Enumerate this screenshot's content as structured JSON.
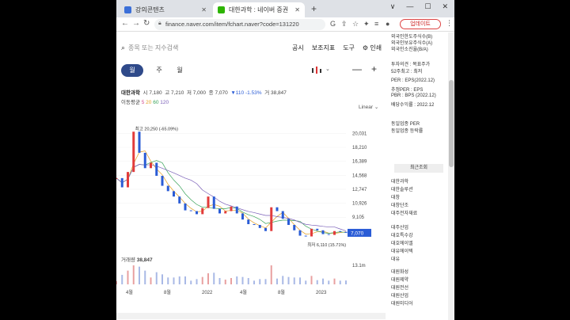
{
  "browser": {
    "tabs": [
      {
        "title": "강의콘텐츠",
        "favicon_color": "#3b6fd8"
      },
      {
        "title": "대한과학 : 네이버 증권",
        "favicon_color": "#2db400"
      }
    ],
    "new_tab": "+",
    "window_controls": [
      "∨",
      "—",
      "☐",
      "✕"
    ],
    "url": "finance.naver.com/item/fchart.naver?code=131220",
    "update_button": "업데이트",
    "menu": "⋮"
  },
  "toolbar": {
    "search_placeholder": "종목 또는 지수검색",
    "links": [
      "공시",
      "보조지표",
      "도구",
      "인쇄"
    ]
  },
  "period_tabs": [
    "월",
    "주",
    "월"
  ],
  "quote": {
    "name": "대한과학",
    "open_label": "시",
    "open": "7,180",
    "high_label": "고",
    "high": "7,210",
    "low_label": "저",
    "low": "7,000",
    "close_label": "종",
    "close": "7,070",
    "change": "▼110",
    "change_pct": "-1.53%",
    "volume_label": "거",
    "volume": "38,847"
  },
  "moving_average": {
    "label": "이동평균",
    "values": [
      "5",
      "20",
      "60",
      "120"
    ],
    "colors": [
      "#d14b8f",
      "#e39d1f",
      "#3aa35a",
      "#7a5fb8"
    ]
  },
  "scale_mode": "Linear",
  "chart_data": {
    "type": "line",
    "ylim": [
      5000,
      21000
    ],
    "y_ticks": [
      "20,031",
      "18,210",
      "16,389",
      "14,568",
      "12,747",
      "10,926",
      "9,105"
    ],
    "x_ticks": [
      "4월",
      "8월",
      "2022",
      "4월",
      "8월",
      "2023"
    ],
    "current_price_tag": "7,070",
    "annotations": [
      {
        "text": "최고 20,250 (-65.09%)",
        "y": 20250
      },
      {
        "text": "최저 6,110 (15.71%)",
        "y": 6110
      }
    ],
    "volume_label": "거래량",
    "volume_value": "38,847",
    "volume_tick": "13.1m",
    "series": [
      {
        "values": [
          14200,
          13000,
          15000,
          20250,
          17500,
          15500,
          16200,
          14500,
          13200,
          12500,
          11800,
          10900,
          10000,
          9900,
          9500,
          10300,
          11800,
          10200,
          9600,
          9900,
          10500,
          9600,
          8800,
          8200,
          8100,
          7700,
          7300,
          10400,
          9900,
          8900,
          8100,
          7400,
          6700,
          6600,
          7600,
          7400,
          6900,
          6800,
          7300,
          7200,
          7070
        ]
      }
    ]
  },
  "right_panel": {
    "lines": [
      "외국인한도주식수(B)",
      "외국인보유주식수(A)",
      "외국인소진율(B/A)",
      "투자의견 : 목표주가",
      "52주최고 : 최저",
      "PER : EPS(2022.12)",
      "추정PER : EPS",
      "PBR : BPS (2022.12)",
      "배당수익률 : 2022.12",
      "동일업종 PER",
      "동일업종 등락률"
    ],
    "recent_title": "최근조회",
    "recent_items": [
      "대한과학",
      "대한솔루션",
      "대창",
      "대창단조",
      "대주전자재료",
      "대주산업",
      "대호특수강",
      "대호에이엘",
      "대유에이텍",
      "대유",
      "대원화성",
      "대원제약",
      "대원전선",
      "대원산업",
      "대원미디어"
    ]
  }
}
